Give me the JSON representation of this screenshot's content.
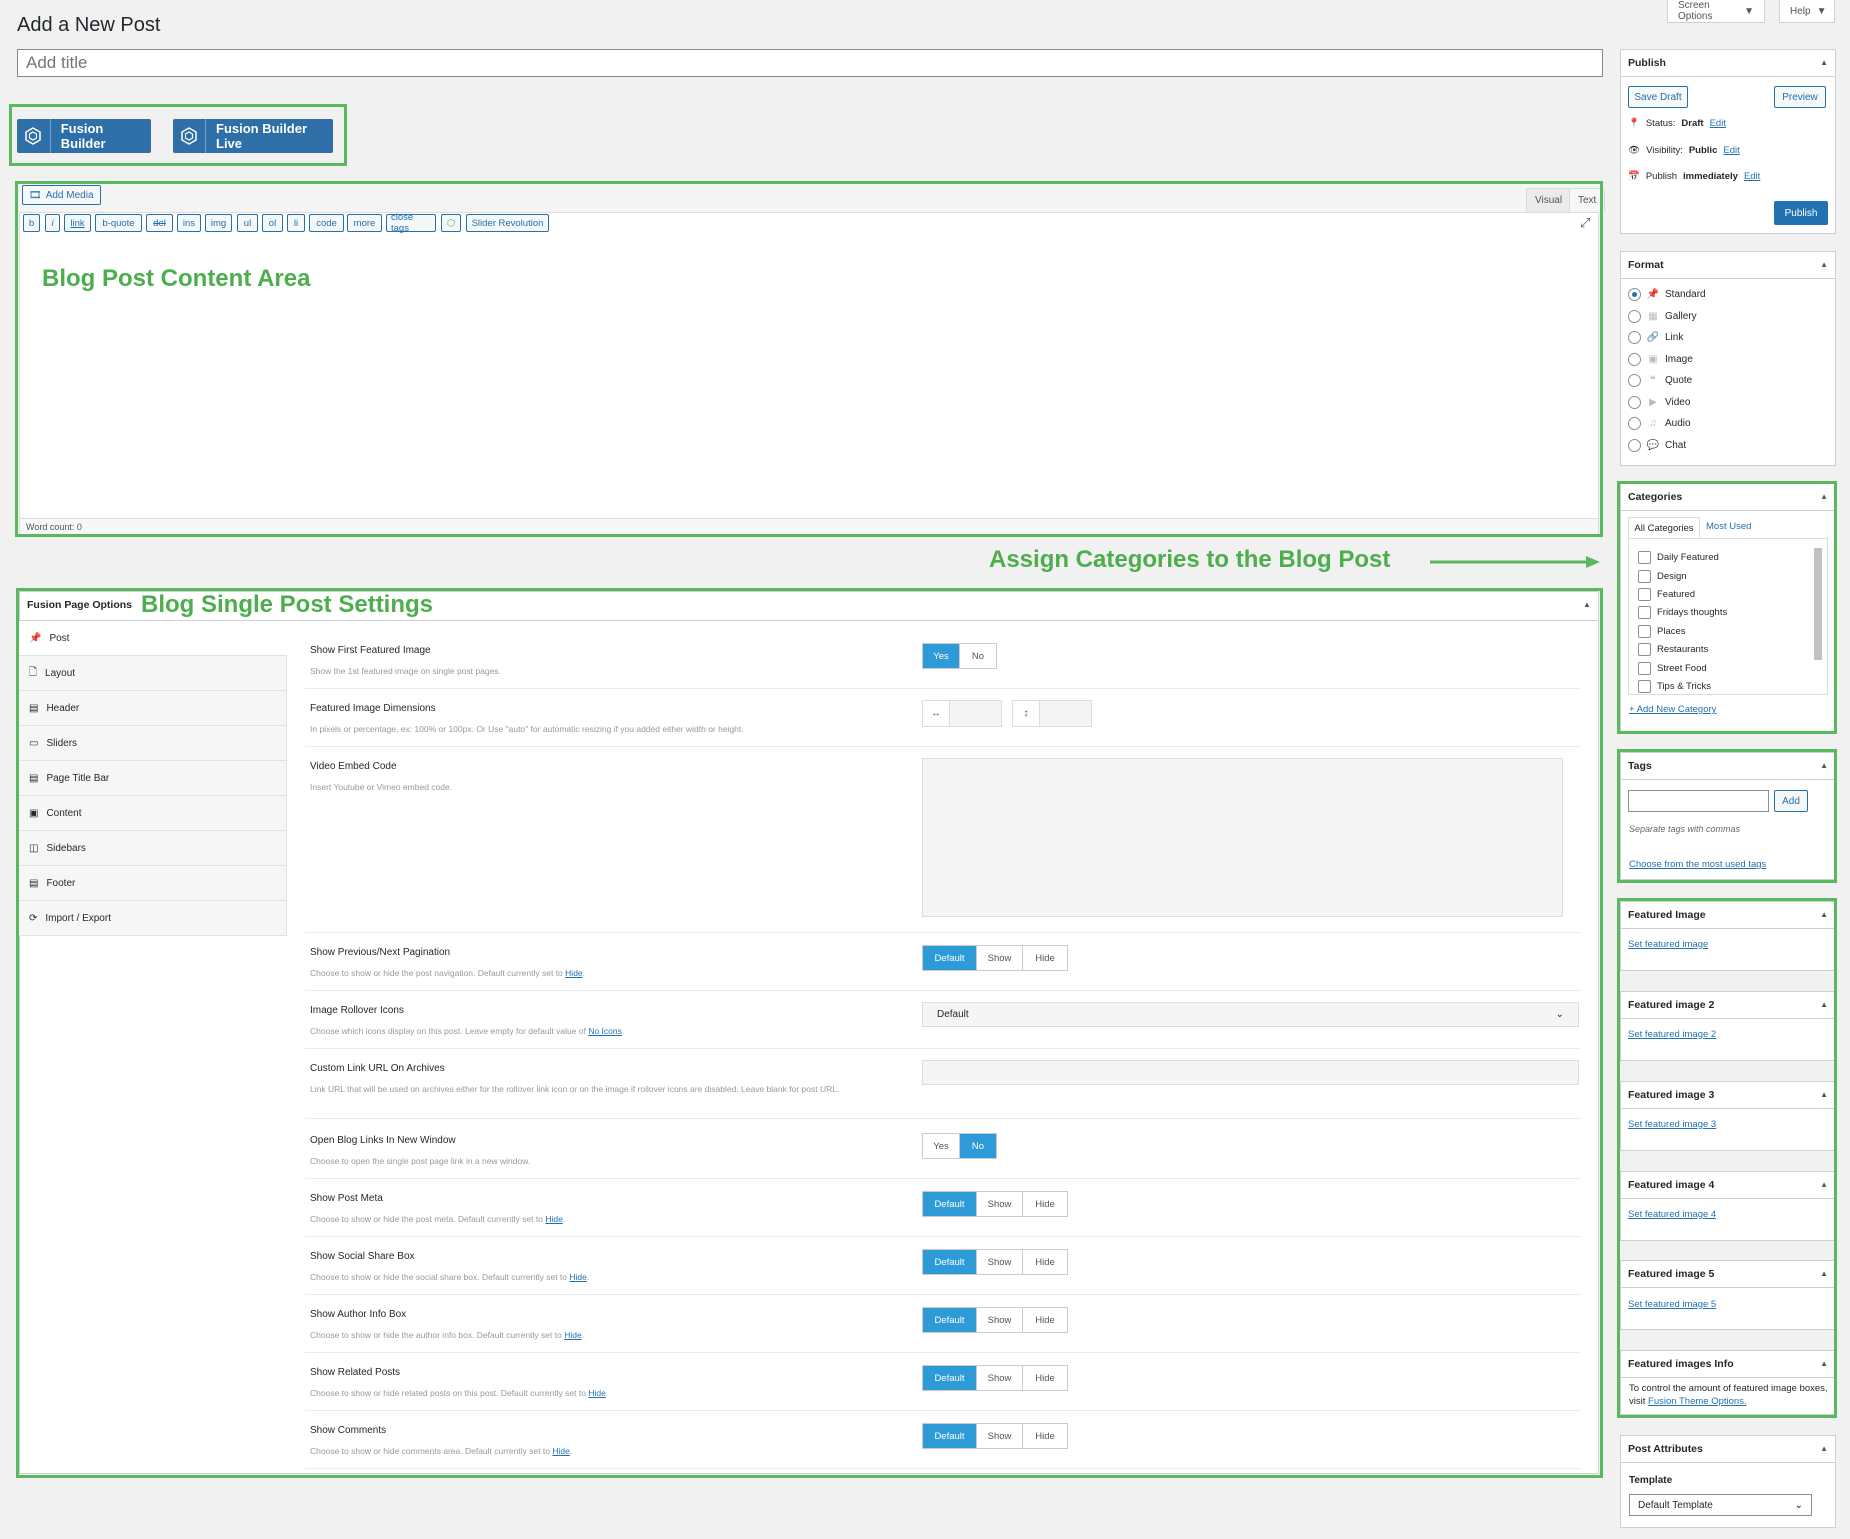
{
  "header": {
    "title": "Add a New Post",
    "screen_options": "Screen Options",
    "help": "Help"
  },
  "title_input": {
    "placeholder": "Add title"
  },
  "builder": {
    "fusion_builder": "Fusion Builder",
    "fusion_builder_live": "Fusion Builder Live"
  },
  "editor": {
    "add_media": "Add Media",
    "tab_visual": "Visual",
    "tab_text": "Text",
    "quicktags": [
      "b",
      "i",
      "link",
      "b-quote",
      "del",
      "ins",
      "img",
      "ul",
      "ol",
      "li",
      "code",
      "more",
      "close tags"
    ],
    "slider_revolution": "Slider Revolution",
    "word_count": "Word count: 0"
  },
  "annotations": {
    "content_area": "Blog Post Content Area",
    "categories": "Assign Categories to the Blog Post",
    "single_post": "Blog Single Post Settings"
  },
  "fusion_options": {
    "title": "Fusion Page Options",
    "tabs": [
      "Post",
      "Layout",
      "Header",
      "Sliders",
      "Page Title Bar",
      "Content",
      "Sidebars",
      "Footer",
      "Import / Export"
    ],
    "options": [
      {
        "label": "Show First Featured Image",
        "desc": "Show the 1st featured image on single post pages.",
        "buttons": [
          "Yes",
          "No"
        ],
        "active": "Yes"
      },
      {
        "label": "Featured Image Dimensions",
        "desc": "In pixels or percentage, ex: 100% or 100px. Or Use \"auto\" for automatic resizing if you added either width or height."
      },
      {
        "label": "Video Embed Code",
        "desc": "Insert Youtube or Vimeo embed code."
      },
      {
        "label": "Show Previous/Next Pagination",
        "desc": "Choose to show or hide the post navigation. Default currently set to",
        "link": "Hide",
        "buttons": [
          "Default",
          "Show",
          "Hide"
        ],
        "active": "Default"
      },
      {
        "label": "Image Rollover Icons",
        "desc": "Choose which icons display on this post. Leave empty for default value of",
        "link": "No Icons",
        "select": "Default"
      },
      {
        "label": "Custom Link URL On Archives",
        "desc": "Link URL that will be used on archives either for the rollover link icon or on the image if rollover icons are disabled. Leave blank for post URL."
      },
      {
        "label": "Open Blog Links In New Window",
        "desc": "Choose to open the single post page link in a new window.",
        "buttons": [
          "Yes",
          "No"
        ],
        "active": "No"
      },
      {
        "label": "Show Post Meta",
        "desc": "Choose to show or hide the post meta. Default currently set to",
        "link": "Hide",
        "buttons": [
          "Default",
          "Show",
          "Hide"
        ],
        "active": "Default"
      },
      {
        "label": "Show Social Share Box",
        "desc": "Choose to show or hide the social share box. Default currently set to",
        "link": "Hide",
        "buttons": [
          "Default",
          "Show",
          "Hide"
        ],
        "active": "Default"
      },
      {
        "label": "Show Author Info Box",
        "desc": "Choose to show or hide the author info box. Default currently set to",
        "link": "Hide",
        "buttons": [
          "Default",
          "Show",
          "Hide"
        ],
        "active": "Default"
      },
      {
        "label": "Show Related Posts",
        "desc": "Choose to show or hide related posts on this post. Default currently set to",
        "link": "Hide",
        "buttons": [
          "Default",
          "Show",
          "Hide"
        ],
        "active": "Default"
      },
      {
        "label": "Show Comments",
        "desc": "Choose to show or hide comments area. Default currently set to",
        "link": "Hide",
        "buttons": [
          "Default",
          "Show",
          "Hide"
        ],
        "active": "Default"
      }
    ]
  },
  "publish": {
    "title": "Publish",
    "save_draft": "Save Draft",
    "preview": "Preview",
    "status_label": "Status:",
    "status_value": "Draft",
    "visibility_label": "Visibility:",
    "visibility_value": "Public",
    "schedule_label": "Publish",
    "schedule_value": "immediately",
    "edit": "Edit",
    "publish_button": "Publish"
  },
  "format": {
    "title": "Format",
    "items": [
      "Standard",
      "Gallery",
      "Link",
      "Image",
      "Quote",
      "Video",
      "Audio",
      "Chat"
    ],
    "selected": "Standard"
  },
  "categories": {
    "title": "Categories",
    "tab_all": "All Categories",
    "tab_most": "Most Used",
    "items": [
      "Daily Featured",
      "Design",
      "Featured",
      "Fridays thoughts",
      "Places",
      "Restaurants",
      "Street Food",
      "Tips & Tricks"
    ],
    "add_new": "+ Add New Category"
  },
  "tags": {
    "title": "Tags",
    "add": "Add",
    "hint": "Separate tags with commas",
    "choose": "Choose from the most used tags"
  },
  "featured_images": [
    {
      "title": "Featured Image",
      "link": "Set featured image"
    },
    {
      "title": "Featured image 2",
      "link": "Set featured image 2"
    },
    {
      "title": "Featured image 3",
      "link": "Set featured image 3"
    },
    {
      "title": "Featured image 4",
      "link": "Set featured image 4"
    },
    {
      "title": "Featured image 5",
      "link": "Set featured image 5"
    }
  ],
  "featured_info": {
    "title": "Featured images Info",
    "text": "To control the amount of featured image boxes, visit",
    "link": "Fusion Theme Options."
  },
  "post_attributes": {
    "title": "Post Attributes",
    "template_label": "Template",
    "template_value": "Default Template"
  },
  "colors": {
    "accent": "#2271b1",
    "toggle_active": "#2e9ad7",
    "annotation": "#5cb85c"
  }
}
